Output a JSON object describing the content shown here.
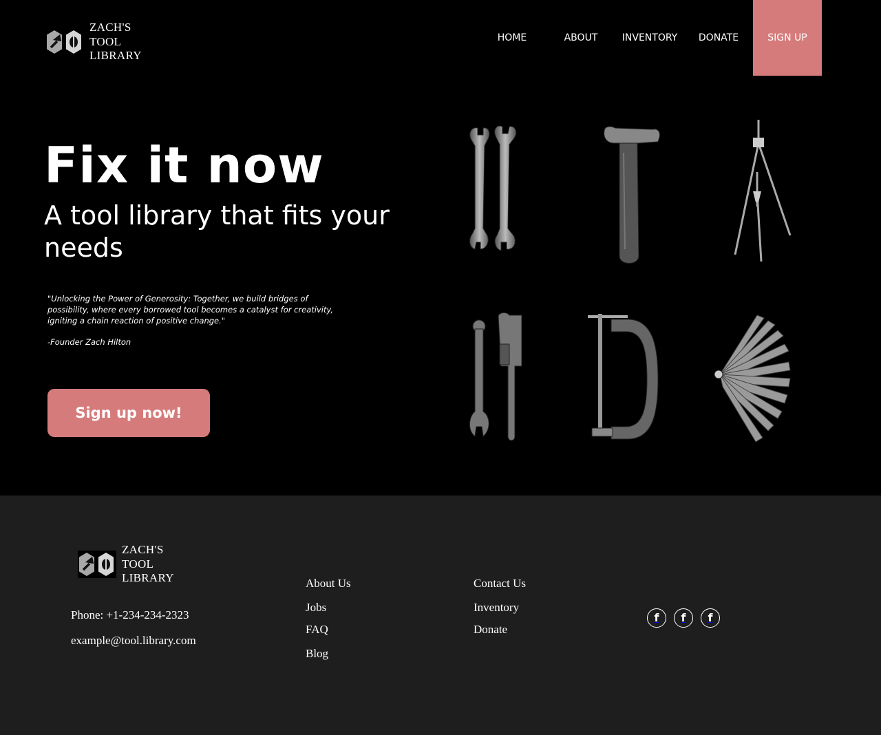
{
  "brand": {
    "name": "ZACH'S\nTOOL\nLIBRARY"
  },
  "nav": {
    "home": "HOME",
    "about": "ABOUT",
    "inventory": "INVENTORY",
    "donate": "DONATE",
    "signup": "SIGN UP"
  },
  "hero": {
    "title": "Fix it now",
    "subtitle": "A tool library that fits your needs",
    "quote": "\"Unlocking the Power of Generosity: Together, we build bridges of possibility, where every borrowed tool becomes a catalyst for creativity, igniting a chain reaction of positive change.\"",
    "quote_author": "-Founder Zach Hilton",
    "cta": "Sign up now!"
  },
  "tools": [
    "wrench-set",
    "hammer",
    "compass-divider",
    "adjustable-and-pipe-wrench",
    "c-clamp",
    "feeler-gauge"
  ],
  "footer": {
    "phone": "Phone: +1-234-234-2323",
    "email": "example@tool.library.com",
    "col1": [
      "About Us",
      "Jobs",
      "FAQ",
      "Blog"
    ],
    "col2": [
      "Contact Us",
      "Inventory",
      "Donate"
    ],
    "social": [
      "f",
      "f",
      "f"
    ]
  },
  "colors": {
    "accent": "#d67b7b",
    "background": "#000000",
    "footer": "#1e1e1e"
  }
}
